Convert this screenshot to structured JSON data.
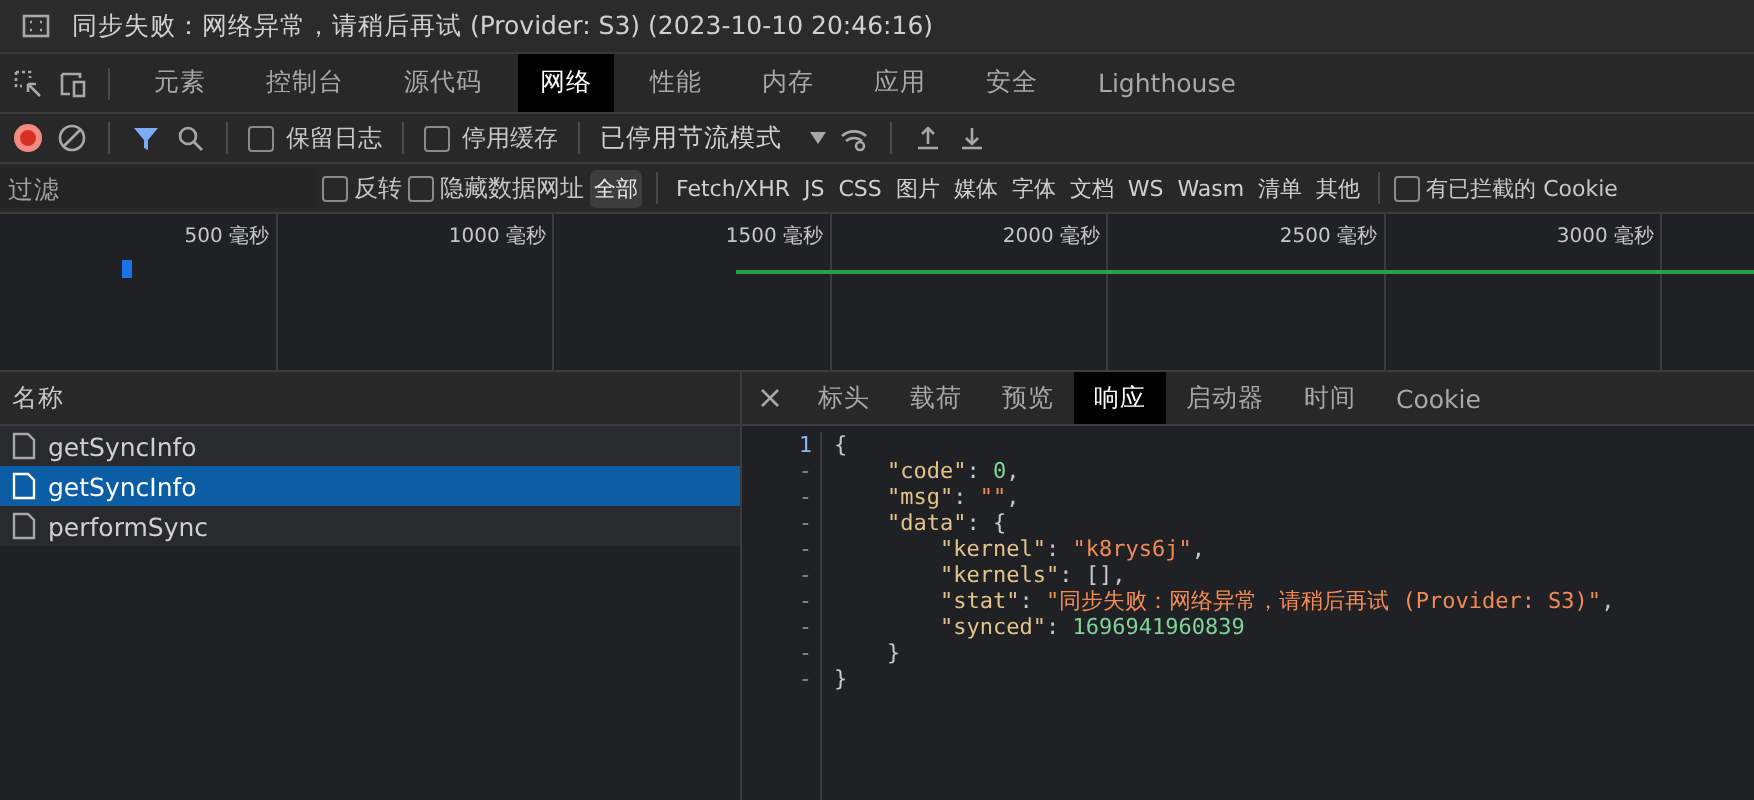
{
  "title_bar": {
    "text": "同步失败：网络异常，请稍后再试 (Provider: S3) (2023-10-10 20:46:16)"
  },
  "main_tabs": [
    {
      "label": "元素",
      "selected": false
    },
    {
      "label": "控制台",
      "selected": false
    },
    {
      "label": "源代码",
      "selected": false
    },
    {
      "label": "网络",
      "selected": true
    },
    {
      "label": "性能",
      "selected": false
    },
    {
      "label": "内存",
      "selected": false
    },
    {
      "label": "应用",
      "selected": false
    },
    {
      "label": "安全",
      "selected": false
    },
    {
      "label": "Lighthouse",
      "selected": false
    }
  ],
  "toolbar": {
    "recording": true,
    "checkboxes": [
      {
        "label": "保留日志",
        "checked": false
      },
      {
        "label": "停用缓存",
        "checked": false
      }
    ],
    "throttling": "已停用节流模式"
  },
  "filter_bar": {
    "placeholder": "过滤",
    "checkboxes": [
      {
        "label": "反转",
        "checked": false
      },
      {
        "label": "隐藏数据网址",
        "checked": false
      }
    ],
    "types": [
      {
        "label": "全部",
        "selected": true
      },
      {
        "label": "Fetch/XHR",
        "selected": false
      },
      {
        "label": "JS",
        "selected": false
      },
      {
        "label": "CSS",
        "selected": false
      },
      {
        "label": "图片",
        "selected": false
      },
      {
        "label": "媒体",
        "selected": false
      },
      {
        "label": "字体",
        "selected": false
      },
      {
        "label": "文档",
        "selected": false
      },
      {
        "label": "WS",
        "selected": false
      },
      {
        "label": "Wasm",
        "selected": false
      },
      {
        "label": "清单",
        "selected": false
      },
      {
        "label": "其他",
        "selected": false
      }
    ],
    "blocked_cookies": {
      "label": "有已拦截的 Cookie",
      "checked": false
    }
  },
  "timeline": {
    "ticks": [
      "500 毫秒",
      "1000 毫秒",
      "1500 毫秒",
      "2000 毫秒",
      "2500 毫秒",
      "3000 毫秒"
    ]
  },
  "requests": {
    "header": "名称",
    "rows": [
      {
        "name": "getSyncInfo",
        "selected": false
      },
      {
        "name": "getSyncInfo",
        "selected": true
      },
      {
        "name": "performSync",
        "selected": false
      }
    ]
  },
  "detail_tabs": [
    {
      "label": "标头",
      "selected": false
    },
    {
      "label": "载荷",
      "selected": false
    },
    {
      "label": "预览",
      "selected": false
    },
    {
      "label": "响应",
      "selected": true
    },
    {
      "label": "启动器",
      "selected": false
    },
    {
      "label": "时间",
      "selected": false
    },
    {
      "label": "Cookie",
      "selected": false
    }
  ],
  "response": {
    "lines": [
      {
        "gutter": "1",
        "tokens": [
          {
            "kind": "punct",
            "text": "{"
          }
        ]
      },
      {
        "gutter": "-",
        "tokens": [
          {
            "kind": "key",
            "text": "    \"code\""
          },
          {
            "kind": "punct",
            "text": ": "
          },
          {
            "kind": "number",
            "text": "0"
          },
          {
            "kind": "punct",
            "text": ","
          }
        ]
      },
      {
        "gutter": "-",
        "tokens": [
          {
            "kind": "key",
            "text": "    \"msg\""
          },
          {
            "kind": "punct",
            "text": ": "
          },
          {
            "kind": "string",
            "text": "\"\""
          },
          {
            "kind": "punct",
            "text": ","
          }
        ]
      },
      {
        "gutter": "-",
        "tokens": [
          {
            "kind": "key",
            "text": "    \"data\""
          },
          {
            "kind": "punct",
            "text": ": {"
          }
        ]
      },
      {
        "gutter": "-",
        "tokens": [
          {
            "kind": "key",
            "text": "        \"kernel\""
          },
          {
            "kind": "punct",
            "text": ": "
          },
          {
            "kind": "string",
            "text": "\"k8rys6j\""
          },
          {
            "kind": "punct",
            "text": ","
          }
        ]
      },
      {
        "gutter": "-",
        "tokens": [
          {
            "kind": "key",
            "text": "        \"kernels\""
          },
          {
            "kind": "punct",
            "text": ": [],"
          }
        ]
      },
      {
        "gutter": "-",
        "tokens": [
          {
            "kind": "key",
            "text": "        \"stat\""
          },
          {
            "kind": "punct",
            "text": ": "
          },
          {
            "kind": "string",
            "text": "\"同步失败：网络异常，请稍后再试 (Provider: S3)\""
          },
          {
            "kind": "punct",
            "text": ","
          }
        ]
      },
      {
        "gutter": "-",
        "tokens": [
          {
            "kind": "key",
            "text": "        \"synced\""
          },
          {
            "kind": "punct",
            "text": ": "
          },
          {
            "kind": "number",
            "text": "1696941960839"
          }
        ]
      },
      {
        "gutter": "-",
        "tokens": [
          {
            "kind": "punct",
            "text": "    }"
          }
        ]
      },
      {
        "gutter": "-",
        "tokens": [
          {
            "kind": "punct",
            "text": "}"
          }
        ]
      }
    ]
  }
}
